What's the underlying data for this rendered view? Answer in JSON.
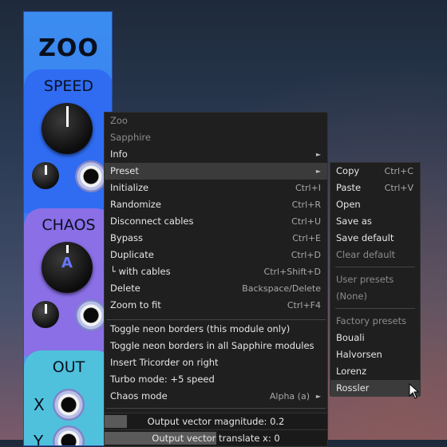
{
  "module": {
    "title": "ZOO",
    "speed_label": "SPEED",
    "chaos_label": "CHAOS",
    "chaos_knob_letter": "A",
    "out_label": "OUT",
    "x_label": "X",
    "y_label": "Y"
  },
  "menu": {
    "header": "Zoo",
    "brand": "Sapphire",
    "items": [
      {
        "label": "Info",
        "shortcut": "",
        "submenu": true
      },
      {
        "label": "Preset",
        "shortcut": "",
        "submenu": true
      },
      {
        "label": "Initialize",
        "shortcut": "Ctrl+I"
      },
      {
        "label": "Randomize",
        "shortcut": "Ctrl+R"
      },
      {
        "label": "Disconnect cables",
        "shortcut": "Ctrl+U"
      },
      {
        "label": "Bypass",
        "shortcut": "Ctrl+E"
      },
      {
        "label": "Duplicate",
        "shortcut": "Ctrl+D"
      },
      {
        "label": "└ with cables",
        "shortcut": "Ctrl+Shift+D"
      },
      {
        "label": "Delete",
        "shortcut": "Backspace/Delete"
      },
      {
        "label": "Zoom to fit",
        "shortcut": "Ctrl+F4"
      }
    ],
    "options": [
      {
        "label": "Toggle neon borders (this module only)"
      },
      {
        "label": "Toggle neon borders in all Sapphire modules"
      },
      {
        "label": "Insert Tricorder on right"
      },
      {
        "label": "Turbo mode: +5 speed"
      },
      {
        "label": "Chaos mode",
        "value": "Alpha (a)",
        "submenu": true
      }
    ],
    "sliders": [
      {
        "label": "Output vector magnitude: 0.2",
        "fraction": 0.1
      },
      {
        "label": "Output vector translate x: 0",
        "fraction": 0.5
      }
    ],
    "arrow_glyph": "►"
  },
  "preset_submenu": {
    "items": [
      {
        "label": "Copy",
        "shortcut": "Ctrl+C"
      },
      {
        "label": "Paste",
        "shortcut": "Ctrl+V"
      },
      {
        "label": "Open",
        "shortcut": ""
      },
      {
        "label": "Save as",
        "shortcut": ""
      },
      {
        "label": "Save default",
        "shortcut": ""
      },
      {
        "label": "Clear default",
        "shortcut": ""
      }
    ],
    "user_presets_header": "User presets",
    "user_presets_empty": "(None)",
    "factory_presets_header": "Factory presets",
    "factory_presets": [
      "Bouali",
      "Halvorsen",
      "Lorenz",
      "Rossler"
    ]
  }
}
